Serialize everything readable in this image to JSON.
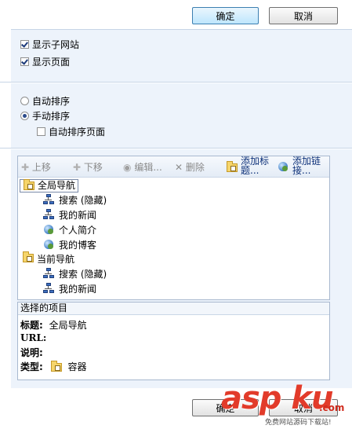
{
  "top_buttons": {
    "ok": "确定",
    "cancel": "取消"
  },
  "display_options": {
    "show_subsites": {
      "label": "显示子网站",
      "checked": true
    },
    "show_pages": {
      "label": "显示页面",
      "checked": true
    }
  },
  "sort_options": {
    "auto": {
      "label": "自动排序",
      "selected": false
    },
    "manual": {
      "label": "手动排序",
      "selected": true
    },
    "auto_sort_pages": {
      "label": "自动排序页面",
      "checked": false
    }
  },
  "toolbar": {
    "move_up": "上移",
    "move_down": "下移",
    "edit": "编辑...",
    "delete": "删除",
    "add_heading": [
      "添加标",
      "题..."
    ],
    "add_link": [
      "添加链",
      "接..."
    ]
  },
  "tree": {
    "global_nav": {
      "label": "全局导航",
      "children": [
        "搜索 (隐藏)",
        "我的新闻",
        "个人简介",
        "我的博客"
      ]
    },
    "current_nav": {
      "label": "当前导航",
      "children": [
        "搜索 (隐藏)",
        "我的新闻"
      ]
    }
  },
  "selected_item": {
    "header": "选择的项目",
    "title_label": "标题:",
    "title_value": "全局导航",
    "url_label": "URL:",
    "url_value": "",
    "desc_label": "说明:",
    "desc_value": "",
    "type_label": "类型:",
    "type_value": "容器"
  },
  "bottom_buttons": {
    "ok": "确定",
    "cancel": "取消"
  },
  "watermark": {
    "brand": "asp ku",
    "tagline": "免费网站源码下载站!",
    "domain": ".com"
  }
}
